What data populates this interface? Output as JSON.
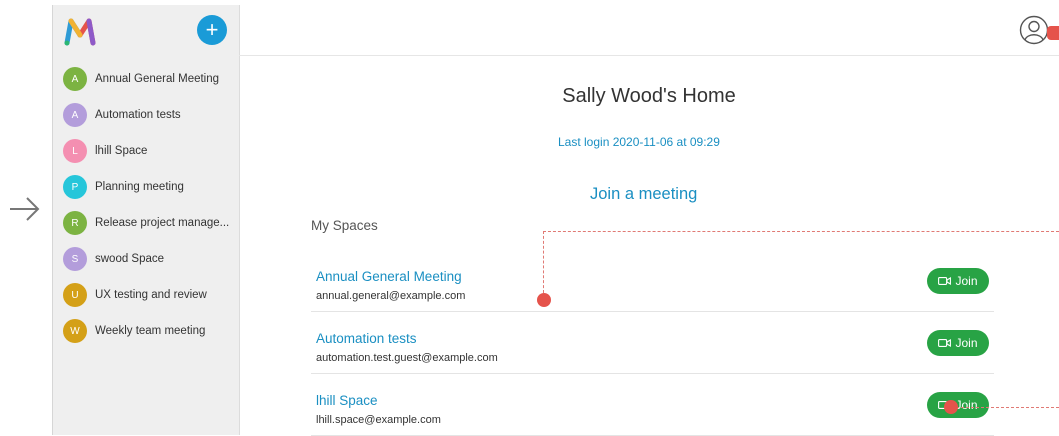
{
  "sidebar": {
    "add_label": "+",
    "items": [
      {
        "initial": "A",
        "label": "Annual General Meeting",
        "color": "#7cb342"
      },
      {
        "initial": "A",
        "label": "Automation tests",
        "color": "#b39ddb"
      },
      {
        "initial": "L",
        "label": "lhill Space",
        "color": "#f48fb1"
      },
      {
        "initial": "P",
        "label": "Planning meeting",
        "color": "#26c6da"
      },
      {
        "initial": "R",
        "label": "Release project manage...",
        "color": "#7cb342"
      },
      {
        "initial": "S",
        "label": "swood Space",
        "color": "#b39ddb"
      },
      {
        "initial": "U",
        "label": "UX testing and review",
        "color": "#d4a017"
      },
      {
        "initial": "W",
        "label": "Weekly team meeting",
        "color": "#d4a017"
      }
    ]
  },
  "main": {
    "title": "Sally Wood's Home",
    "last_login": "Last login 2020-11-06 at 09:29",
    "join_link": "Join a meeting",
    "spaces_heading": "My Spaces",
    "spaces": [
      {
        "title": "Annual General Meeting",
        "email": "annual.general@example.com",
        "join": "Join"
      },
      {
        "title": "Automation tests",
        "email": "automation.test.guest@example.com",
        "join": "Join"
      },
      {
        "title": "lhill Space",
        "email": "lhill.space@example.com",
        "join": "Join"
      }
    ]
  },
  "colors": {
    "accent": "#1a8fc2",
    "join_green": "#28a345",
    "marker": "#e5534b"
  }
}
